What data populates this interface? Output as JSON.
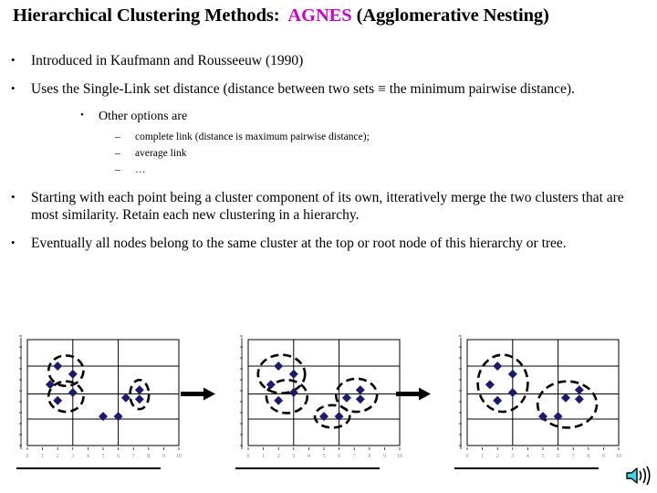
{
  "slide": {
    "title_prefix": "Hierarchical Clustering Methods:  ",
    "title_accent": "AGNES",
    "title_suffix": " (Agglomerative Nesting)"
  },
  "bullets": {
    "level1": [
      {
        "marker": "•",
        "text": "Introduced in Kaufmann and Rousseeuw (1990)"
      },
      {
        "marker": "•",
        "text": "Uses the Single-Link set distance (distance between two sets ≡ the minimum pairwise distance)."
      },
      {
        "marker": "•",
        "text": "Starting with each point being a cluster component of its own, itteratively merge the two clusters that are most similarity.  Retain each new clustering in a hierarchy."
      },
      {
        "marker": "•",
        "text": "Eventually all nodes belong to the same cluster at the top or root node of this hierarchy or tree."
      }
    ],
    "level2": [
      {
        "marker": "•",
        "text": "Other options are"
      }
    ],
    "level3": [
      {
        "marker": "–",
        "text": "complete link (distance is maximum pairwise distance);"
      },
      {
        "marker": "–",
        "text": "average link"
      },
      {
        "marker": "–",
        "text": "…"
      }
    ]
  },
  "figures": {
    "arrow_glyph": "→",
    "marker_color": "#1b1b6e",
    "cluster_outline_color": "#000000",
    "axis_color": "#000000",
    "panels": [
      {
        "name": "step-1-singletons",
        "points": [
          [
            2,
            6
          ],
          [
            3,
            5.4
          ],
          [
            1.5,
            4.6
          ],
          [
            3,
            4
          ],
          [
            2,
            3.4
          ],
          [
            6.5,
            3.6
          ],
          [
            7.4,
            4.2
          ],
          [
            7.4,
            3.5
          ],
          [
            5,
            2.2
          ],
          [
            6,
            2.2
          ]
        ],
        "clusters": [
          {
            "cx": 2.55,
            "cy": 5.65,
            "rx": 1.15,
            "ry": 1.15
          },
          {
            "cx": 2.55,
            "cy": 3.7,
            "rx": 1.15,
            "ry": 1.15
          },
          {
            "cx": 7.4,
            "cy": 3.85,
            "rx": 0.62,
            "ry": 1.1
          }
        ]
      },
      {
        "name": "step-2-merged",
        "points": [
          [
            2,
            6
          ],
          [
            3,
            5.4
          ],
          [
            1.5,
            4.6
          ],
          [
            3,
            4
          ],
          [
            2,
            3.4
          ],
          [
            6.5,
            3.6
          ],
          [
            7.4,
            4.2
          ],
          [
            7.4,
            3.5
          ],
          [
            5,
            2.2
          ],
          [
            6,
            2.2
          ]
        ],
        "clusters": [
          {
            "cx": 2.2,
            "cy": 5.4,
            "rx": 1.55,
            "ry": 1.45
          },
          {
            "cx": 2.55,
            "cy": 3.7,
            "rx": 1.35,
            "ry": 1.25
          },
          {
            "cx": 7.15,
            "cy": 3.8,
            "rx": 1.35,
            "ry": 1.25
          },
          {
            "cx": 5.55,
            "cy": 2.2,
            "rx": 1.15,
            "ry": 0.85
          }
        ]
      },
      {
        "name": "step-3-two-clusters",
        "points": [
          [
            2,
            6
          ],
          [
            3,
            5.4
          ],
          [
            1.5,
            4.6
          ],
          [
            3,
            4
          ],
          [
            2,
            3.4
          ],
          [
            6.5,
            3.6
          ],
          [
            7.4,
            4.2
          ],
          [
            7.4,
            3.5
          ],
          [
            5,
            2.2
          ],
          [
            6,
            2.2
          ]
        ],
        "clusters": [
          {
            "cx": 2.35,
            "cy": 4.7,
            "rx": 1.65,
            "ry": 2.15
          },
          {
            "cx": 6.6,
            "cy": 3.1,
            "rx": 1.95,
            "ry": 1.75
          }
        ]
      }
    ],
    "axis": {
      "x_ticks": [
        "0",
        "1",
        "2",
        "3",
        "4",
        "5",
        "6",
        "7",
        "8",
        "9",
        "10"
      ],
      "y_ticks": [
        "0",
        "1",
        "2",
        "3",
        "4",
        "5",
        "6",
        "7",
        "8",
        "9",
        "10"
      ],
      "xlim": [
        0,
        10
      ],
      "ylim": [
        0,
        8
      ],
      "x_gridlines": [
        3,
        6
      ],
      "y_gridlines": [
        2,
        3.9,
        6
      ]
    }
  },
  "status": {
    "sound_icon": "speaker-icon"
  }
}
